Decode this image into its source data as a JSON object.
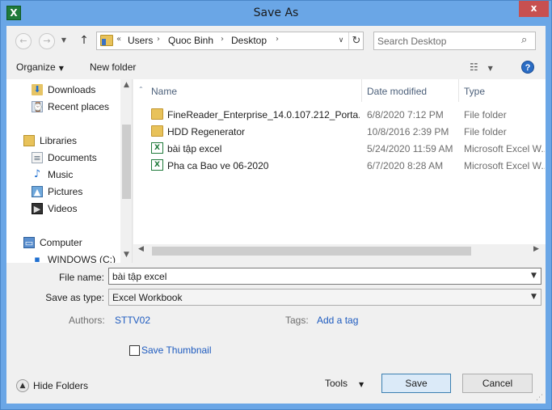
{
  "window": {
    "title": "Save As",
    "app_icon": "excel-icon",
    "close_glyph": "x",
    "accent_color": "#6aa6e6"
  },
  "navigation": {
    "back_glyph": "←",
    "forward_glyph": "→",
    "up_glyph": "↑",
    "breadcrumb_overflow": "«",
    "breadcrumb": [
      "Users",
      "Quoc Binh",
      "Desktop"
    ],
    "refresh_glyph": "↻",
    "search_placeholder": "Search Desktop"
  },
  "toolbar": {
    "organize_label": "Organize",
    "new_folder_label": "New folder",
    "help_glyph": "?"
  },
  "nav_pane": {
    "items": [
      {
        "label": "Downloads",
        "icon": "downloads-icon",
        "glyph": "⬇"
      },
      {
        "label": "Recent places",
        "icon": "recent-places-icon",
        "glyph": "⌚"
      },
      {
        "label": "Libraries",
        "icon": "libraries-icon",
        "glyph": ""
      },
      {
        "label": "Documents",
        "icon": "documents-icon",
        "glyph": "≡"
      },
      {
        "label": "Music",
        "icon": "music-icon",
        "glyph": "♪"
      },
      {
        "label": "Pictures",
        "icon": "pictures-icon",
        "glyph": "▲"
      },
      {
        "label": "Videos",
        "icon": "videos-icon",
        "glyph": "▶"
      },
      {
        "label": "Computer",
        "icon": "computer-icon",
        "glyph": "▭"
      },
      {
        "label": "WINDOWS (C:)",
        "icon": "drive-icon",
        "glyph": "▪"
      }
    ]
  },
  "file_list": {
    "columns": [
      "Name",
      "Date modified",
      "Type"
    ],
    "rows": [
      {
        "name": "FineReader_Enterprise_14.0.107.212_Porta...",
        "date": "6/8/2020 7:12 PM",
        "type": "File folder",
        "icon": "folder-icon"
      },
      {
        "name": "HDD Regenerator",
        "date": "10/8/2016 2:39 PM",
        "type": "File folder",
        "icon": "folder-icon"
      },
      {
        "name": "bài tập excel",
        "date": "5/24/2020 11:59 AM",
        "type": "Microsoft Excel W...",
        "icon": "excel-file-icon"
      },
      {
        "name": "Pha ca Bao ve 06-2020",
        "date": "6/7/2020 8:28 AM",
        "type": "Microsoft Excel W...",
        "icon": "excel-file-icon"
      }
    ]
  },
  "form": {
    "file_name_label": "File name:",
    "file_name_value": "bài tập excel",
    "save_as_type_label": "Save as type:",
    "save_as_type_value": "Excel Workbook",
    "authors_label": "Authors:",
    "authors_value": "STTV02",
    "tags_label": "Tags:",
    "tags_value": "Add a tag",
    "save_thumbnail_label": "Save Thumbnail"
  },
  "footer": {
    "hide_folders_label": "Hide Folders",
    "tools_label": "Tools",
    "save_label": "Save",
    "cancel_label": "Cancel"
  }
}
